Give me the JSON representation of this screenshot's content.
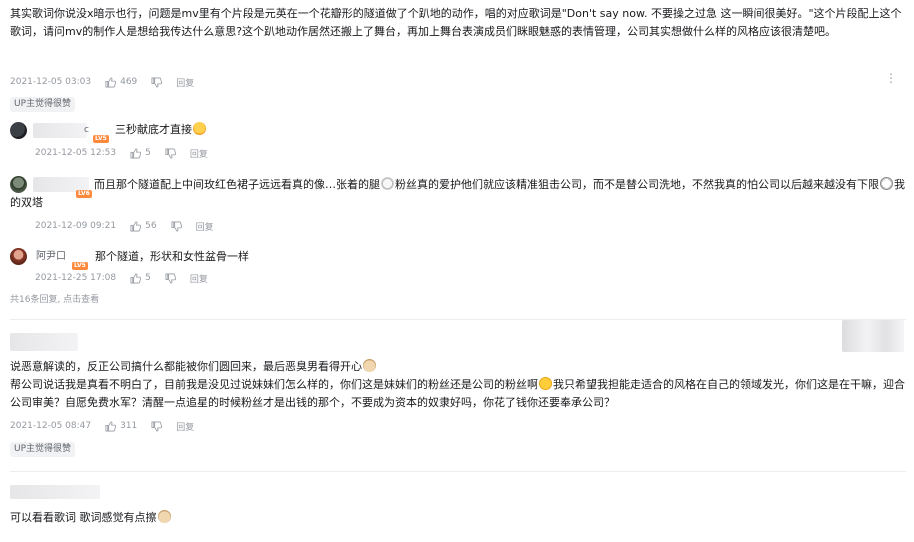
{
  "comments": [
    {
      "text": "其实歌词你说没x暗示也行，问题是mv里有个片段是元英在一个花瓣形的隧道做了个趴地的动作，唱的对应歌词是\"Don't say now. 不要操之过急 这一瞬间很美好。\"这个片段配上这个歌词，请问mv的制作人是想给我传达什么意思?这个趴地动作居然还搬上了舞台，再加上舞台表演成员们眯眼魅惑的表情管理，公司其实想做什么样的风格应该很清楚吧。",
      "time": "2021-12-05 03:03",
      "likes": "469",
      "reply_label": "回复",
      "badge": "UP主觉得很赞",
      "more_icon": "⋮",
      "replies": [
        {
          "user_suffix": "c",
          "level": "LV5",
          "text": "三秒献底才直接",
          "time": "2021-12-05 12:53",
          "likes": "5",
          "reply_label": "回复"
        },
        {
          "level": "LV6",
          "text_a": "而且那个隧道配上中间玫红色裙子远远看真的像…张着的腿",
          "text_b": "粉丝真的爱护他们就应该精准狙击公司，而不是替公司洗地，不然我真的怕公司以后越来越没有下限",
          "text_c": "我的双塔",
          "time": "2021-12-09 09:21",
          "likes": "56",
          "reply_label": "回复"
        },
        {
          "user": "阿尹口",
          "level": "LV5",
          "text": "那个隧道，形状和女性盆骨一样",
          "time": "2021-12-25 17:08",
          "likes": "5",
          "reply_label": "回复"
        }
      ],
      "replies_summary": "共16条回复, 点击查看"
    },
    {
      "text_line1": "说恶意解读的，反正公司搞什么都能被你们圆回来，最后恶臭男看得开心",
      "text_line2a": "帮公司说话我是真看不明白了，目前我是没见过说妹妹们怎么样的，你们这是妹妹们的粉丝还是公司的粉丝啊",
      "text_line2b": "我只希望我担能走适合的风格在自己的领域发光，你们这是在干嘛，迎合公司审美？自愿免费水军？清醒一点追星的时候粉丝才是出钱的那个，不要成为资本的奴隶好吗，你花了钱你还要奉承公司？",
      "time": "2021-12-05 08:47",
      "likes": "311",
      "reply_label": "回复",
      "badge": "UP主觉得很赞"
    },
    {
      "text": "可以看看歌词 歌词感觉有点擦"
    }
  ]
}
